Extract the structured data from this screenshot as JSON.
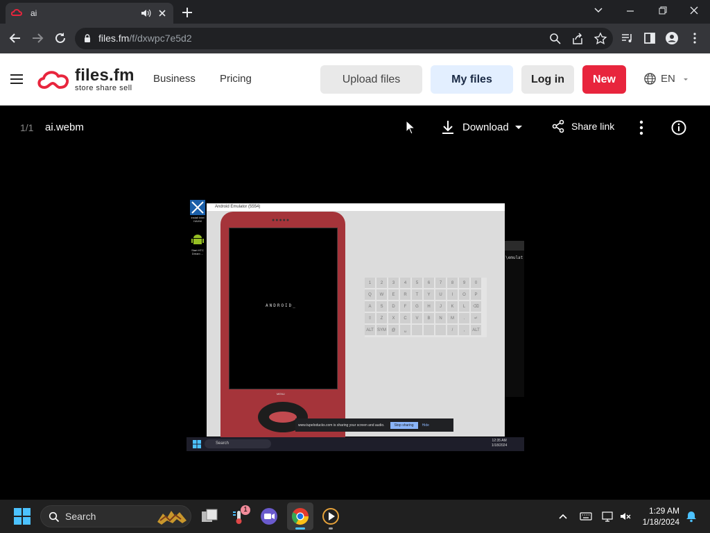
{
  "browser": {
    "tab_title": "ai",
    "url_domain": "files.fm",
    "url_path": "/f/dxwpc7e5d2"
  },
  "site": {
    "logo_text": "files.fm",
    "logo_tagline": "store share sell",
    "nav": [
      "Business",
      "Pricing"
    ],
    "buttons": {
      "upload": "Upload files",
      "my_files": "My files",
      "login": "Log in",
      "new": "New"
    },
    "language": "EN",
    "colors": {
      "accent_red": "#e8253d",
      "my_files_bg": "#e3efff",
      "upload_bg": "#e9e9e9"
    }
  },
  "viewer": {
    "counter": "1/1",
    "file_name": "ai.webm",
    "download_label": "Download",
    "share_label": "Share link"
  },
  "video_frame": {
    "emulator_title": "Android Emulator (5554)",
    "screen_text": "ANDROID_",
    "menu_label": "MENU",
    "desktop_icons": [
      "Install Intel HAXM",
      "Start HTC Dream ..."
    ],
    "keyboard_rows": [
      [
        "1",
        "2",
        "3",
        "4",
        "5",
        "6",
        "7",
        "8",
        "9",
        "0"
      ],
      [
        "Q",
        "W",
        "E",
        "R",
        "T",
        "Y",
        "U",
        "I",
        "O",
        "P"
      ],
      [
        "A",
        "S",
        "D",
        "F",
        "G",
        "H",
        "J",
        "K",
        "L",
        "⌫"
      ],
      [
        "⇧",
        "Z",
        "X",
        "C",
        "V",
        "B",
        "N",
        "M",
        ".",
        "↵"
      ],
      [
        "ALT",
        "SYM",
        "@",
        "␣",
        "",
        "",
        "",
        "/",
        ",",
        "ALT"
      ]
    ],
    "share_notice": "www.tupeloducks.com is sharing your screen and audio.",
    "stop_sharing": "Stop sharing",
    "hide": "Hide",
    "terminal_text": "\\emulat",
    "inner_search": "Search",
    "inner_time": "12:35 AM",
    "inner_date": "1/18/2024"
  },
  "taskbar": {
    "search_label": "Search",
    "badge_count": "1",
    "time": "1:29 AM",
    "date": "1/18/2024"
  }
}
